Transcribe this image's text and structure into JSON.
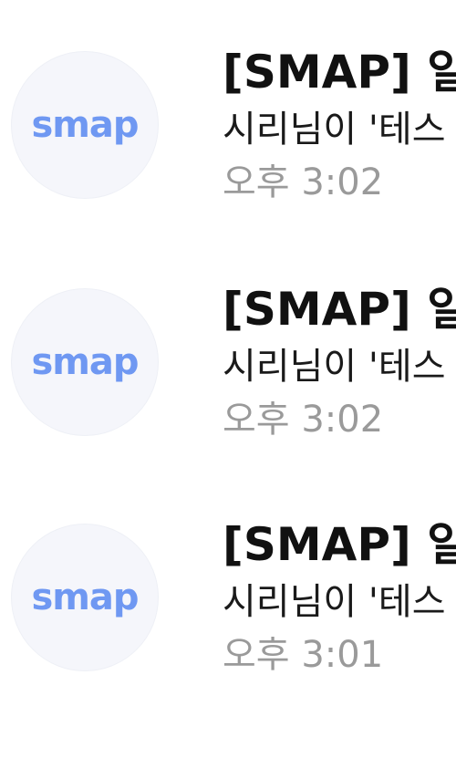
{
  "notifications": [
    {
      "avatar_logo": "smap",
      "title": "[SMAP] 일",
      "body": "시리님이 '테스",
      "time": "오후 3:02"
    },
    {
      "avatar_logo": "smap",
      "title": "[SMAP] 일",
      "body": "시리님이 '테스",
      "time": "오후 3:02"
    },
    {
      "avatar_logo": "smap",
      "title": "[SMAP] 일",
      "body": "시리님이 '테스",
      "time": "오후 3:01"
    }
  ],
  "colors": {
    "logo": "#6f98f2",
    "avatar_bg": "#f5f6fb",
    "title": "#111111",
    "time": "#9a9a9a"
  }
}
